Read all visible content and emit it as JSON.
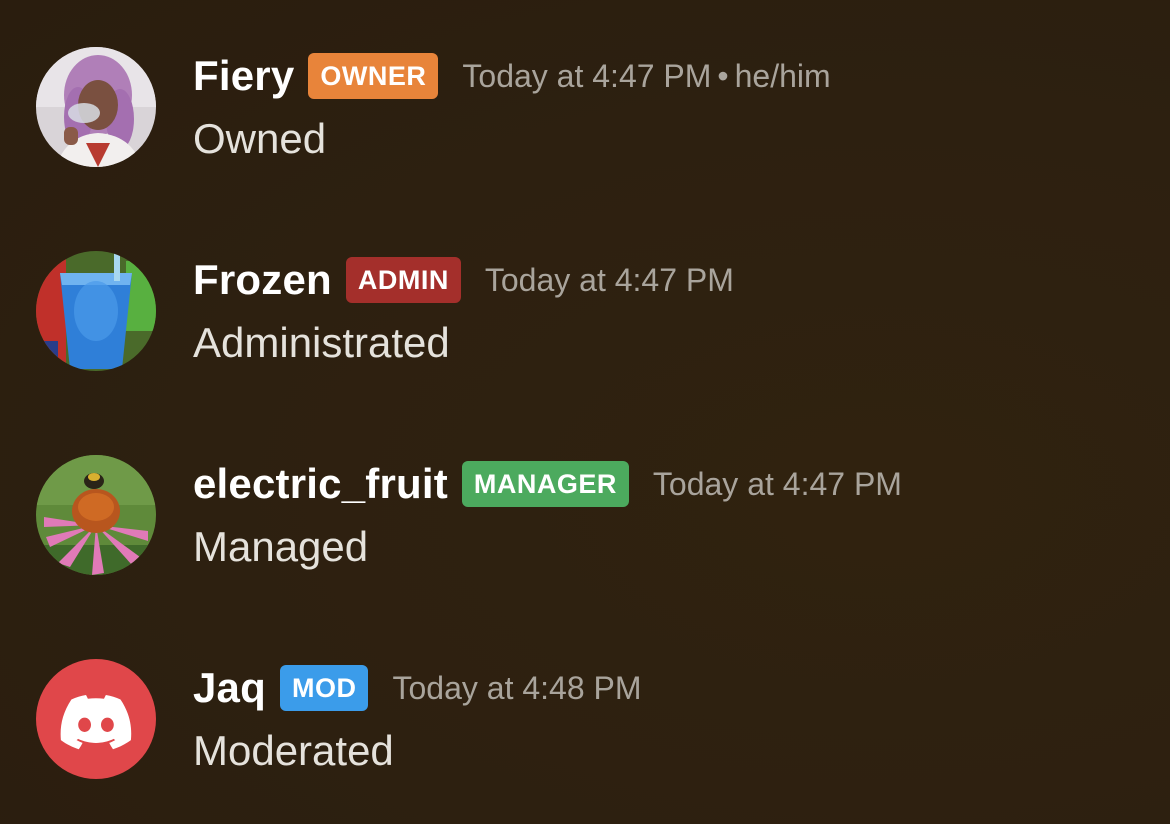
{
  "colors": {
    "background": "#2e2110",
    "owner_badge": "#e8843a",
    "admin_badge": "#a42f2b",
    "manager_badge": "#4caa5e",
    "mod_badge": "#3b9cea",
    "discord_red": "#e0474a"
  },
  "messages": [
    {
      "username": "Fiery",
      "role": "OWNER",
      "timestamp": "Today at 4:47 PM",
      "separator": "•",
      "pronouns": "he/him",
      "content": "Owned",
      "avatar": "person-purple-hair-photo"
    },
    {
      "username": "Frozen",
      "role": "ADMIN",
      "timestamp": "Today at 4:47 PM",
      "content": "Administrated",
      "avatar": "blue-slushie-photo"
    },
    {
      "username": "electric_fruit",
      "role": "MANAGER",
      "timestamp": "Today at 4:47 PM",
      "content": "Managed",
      "avatar": "coneflower-bee-photo"
    },
    {
      "username": "Jaq",
      "role": "MOD",
      "timestamp": "Today at 4:48 PM",
      "content": "Moderated",
      "avatar": "discord-logo-icon"
    }
  ]
}
